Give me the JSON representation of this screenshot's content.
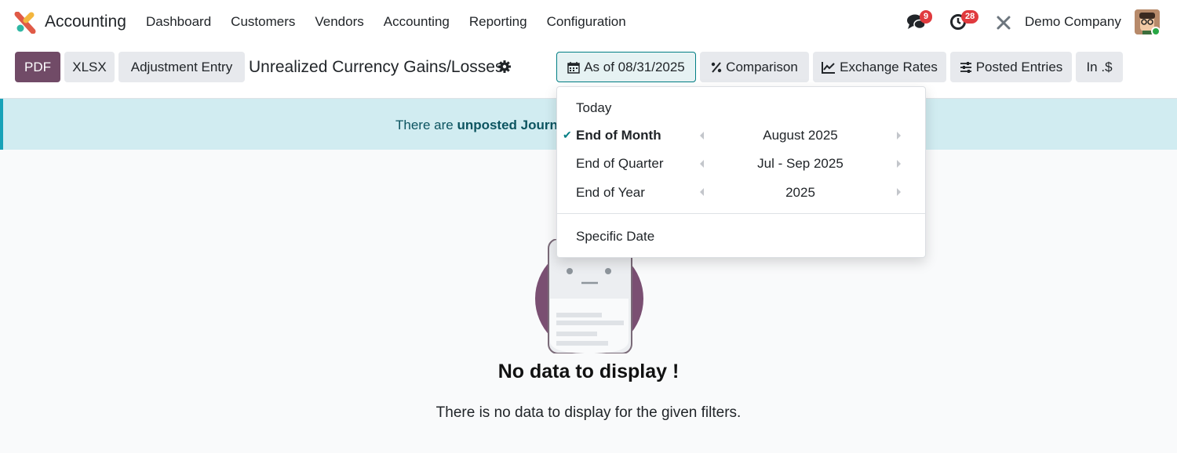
{
  "navbar": {
    "app_name": "Accounting",
    "menu": [
      "Dashboard",
      "Customers",
      "Vendors",
      "Accounting",
      "Reporting",
      "Configuration"
    ],
    "messages_badge": "9",
    "activities_badge": "28",
    "company": "Demo Company"
  },
  "control_panel": {
    "pdf_label": "PDF",
    "xlsx_label": "XLSX",
    "adjustment_label": "Adjustment Entry",
    "report_title": "Unrealized Currency Gains/Losses",
    "date_filter_label": "As of 08/31/2025",
    "comparison_label": "Comparison",
    "exchange_rates_label": "Exchange Rates",
    "posted_entries_label": "Posted Entries",
    "currency_label": "In .$"
  },
  "banner": {
    "text_prefix": "There are ",
    "text_bold": "unposted Journal"
  },
  "date_dropdown": {
    "today": "Today",
    "end_of_month": "End of Month",
    "end_of_month_value": "August 2025",
    "end_of_quarter": "End of Quarter",
    "end_of_quarter_value": "Jul - Sep 2025",
    "end_of_year": "End of Year",
    "end_of_year_value": "2025",
    "specific_date": "Specific Date",
    "selected": "End of Month"
  },
  "empty_state": {
    "title": "No data to display !",
    "subtitle": "There is no data to display for the given filters."
  },
  "colors": {
    "primary": "#714b67",
    "accent": "#017e84",
    "banner_bg": "#d1ecf1"
  }
}
